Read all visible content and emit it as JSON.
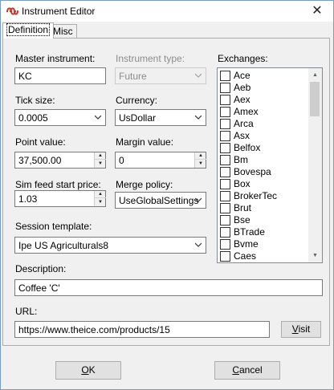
{
  "window": {
    "title": "Instrument Editor",
    "close_glyph": "✕"
  },
  "tabs": [
    {
      "label": "Definition",
      "active": true
    },
    {
      "label": "Misc",
      "active": false
    }
  ],
  "fields": {
    "master_instrument": {
      "label": "Master instrument:",
      "value": "KC"
    },
    "instrument_type": {
      "label": "Instrument type:",
      "value": "Future",
      "disabled": true
    },
    "tick_size": {
      "label": "Tick size:",
      "value": "0.0005"
    },
    "currency": {
      "label": "Currency:",
      "value": "UsDollar"
    },
    "point_value": {
      "label": "Point value:",
      "value": "37,500.00"
    },
    "margin_value": {
      "label": "Margin value:",
      "value": "0"
    },
    "sim_feed_start_price": {
      "label": "Sim feed start price:",
      "value": "1.03"
    },
    "merge_policy": {
      "label": "Merge policy:",
      "value": "UseGlobalSettings"
    },
    "session_template": {
      "label": "Session template:",
      "value": "Ipe US Agriculturals8"
    },
    "description": {
      "label": "Description:",
      "value": "Coffee 'C'"
    },
    "url": {
      "label": "URL:",
      "value": "https://www.theice.com/products/15"
    }
  },
  "exchanges": {
    "label": "Exchanges:",
    "items": [
      "Ace",
      "Aeb",
      "Aex",
      "Amex",
      "Arca",
      "Asx",
      "Belfox",
      "Bm",
      "Bovespa",
      "Box",
      "BrokerTec",
      "Brut",
      "Bse",
      "BTrade",
      "Bvme",
      "Caes"
    ]
  },
  "buttons": {
    "visit": {
      "prefix": "",
      "mnemonic": "V",
      "rest": "isit"
    },
    "ok": {
      "prefix": "",
      "mnemonic": "O",
      "rest": "K"
    },
    "cancel": {
      "prefix": "",
      "mnemonic": "C",
      "rest": "ancel"
    }
  },
  "colors": {
    "window_bg": "#f0f0f0",
    "border": "#7a7a7a",
    "button_bg": "#e1e1e1",
    "icon_red": "#c0392b"
  }
}
